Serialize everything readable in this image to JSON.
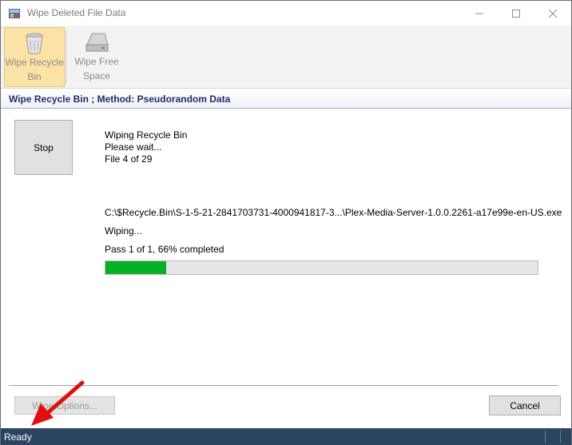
{
  "window": {
    "title": "Wipe Deleted File Data"
  },
  "toolbar": {
    "wipe_recycle_bin_label_line1": "Wipe Recycle",
    "wipe_recycle_bin_label_line2": "Bin",
    "wipe_free_space_label_line1": "Wipe Free",
    "wipe_free_space_label_line2": "Space"
  },
  "method_header": "Wipe Recycle Bin ; Method: Pseudorandom Data",
  "controls": {
    "stop_label": "Stop",
    "wipe_options_label": "Wipe Options...",
    "cancel_label": "Cancel"
  },
  "status": {
    "line1": "Wiping Recycle Bin",
    "line2": "Please wait...",
    "line3": "File 4 of 29",
    "file_path": "C:\\$Recycle.Bin\\S-1-5-21-2841703731-4000941817-3...\\Plex-Media-Server-1.0.0.2261-a17e99e-en-US.exe",
    "wiping": "Wiping...",
    "pass_text": "Pass 1 of 1,  66% completed",
    "progress_fraction": 0.14
  },
  "statusbar": {
    "text": "Ready"
  },
  "icons": {
    "app": "app-icon",
    "recycle_bin": "recycle-bin-icon",
    "free_space": "drive-icon"
  },
  "colors": {
    "progress_fill": "#06b025",
    "statusbar_bg": "#2b4462",
    "header_text": "#1e2d66",
    "toolbar_active": "#fbe3a6",
    "annotation_arrow": "#e01010"
  }
}
